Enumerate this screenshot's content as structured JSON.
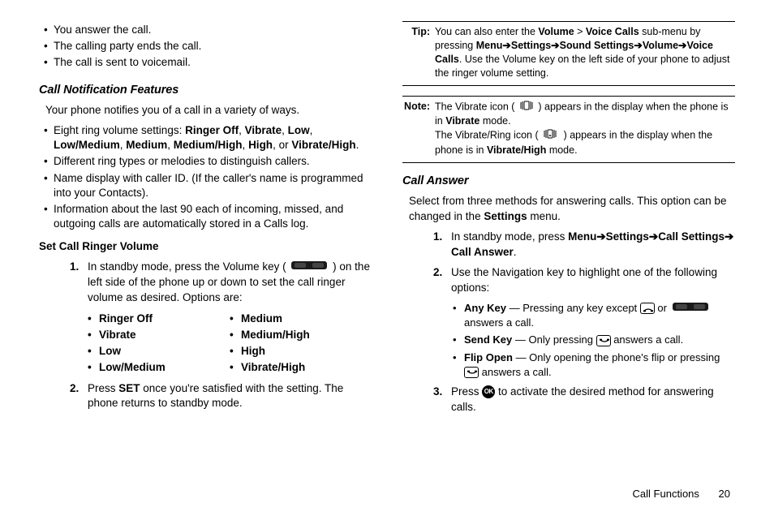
{
  "left": {
    "top_bullets": [
      "You answer the call.",
      "The calling party ends the call.",
      "The call is sent to voicemail."
    ],
    "callnotif_heading": "Call Notification Features",
    "callnotif_intro": "Your phone notifies you of a call in a variety of ways.",
    "feature_bullets": {
      "b1": {
        "pre": "Eight ring volume settings: ",
        "opts": [
          "Ringer Off",
          "Vibrate",
          "Low",
          "Low/Medium",
          "Medium",
          "Medium/High",
          "High",
          "Vibrate/High"
        ],
        "sep": ", ",
        "last_sep": ", or ",
        "end": "."
      },
      "b2": "Different ring types or melodies to distinguish callers.",
      "b3": "Name display with caller ID. (If the caller's name is programmed into your Contacts).",
      "b4": "Information about the last 90 each of incoming, missed, and outgoing calls are automatically stored in a Calls log."
    },
    "setvol_heading": "Set Call Ringer Volume",
    "step1": {
      "num": "1.",
      "pre": "In standby mode, press the Volume key (",
      "post": ") on the left side of the phone up or down to set the call ringer volume as desired. Options are:"
    },
    "opt_col1": [
      "Ringer Off",
      "Vibrate",
      "Low",
      "Low/Medium"
    ],
    "opt_col2": [
      "Medium",
      "Medium/High",
      "High",
      "Vibrate/High"
    ],
    "step2": {
      "num": "2.",
      "text_a": "Press ",
      "bold": "SET",
      "text_b": "  once you're satisfied with the setting. The phone returns to standby mode."
    }
  },
  "right": {
    "tip": {
      "label": "Tip:",
      "parts": {
        "a": "You can also enter the ",
        "vol": "Volume",
        "gt": " > ",
        "vc": "Voice Calls",
        "b": " sub-menu by pressing ",
        "menu": "Menu",
        "arr": " ➔ ",
        "settings": "Settings",
        "ss": "Sound Settings",
        "volume2": "Volume",
        "vc2": "Voice Calls",
        "c": ". Use the Volume key on the left side of your phone to adjust the ringer volume setting."
      }
    },
    "note": {
      "label": "Note:",
      "l1a": "The Vibrate icon (",
      "l1b": ") appears in the display when the phone is in ",
      "l1c": "Vibrate",
      "l1d": " mode.",
      "l2a": "The Vibrate/Ring icon (",
      "l2b": ") appears in the display when the phone is in ",
      "l2c": "Vibrate/High",
      "l2d": " mode."
    },
    "callanswer_heading": "Call Answer",
    "ca_intro_a": "Select from three methods for answering calls. This option can be changed in the ",
    "ca_intro_bold": "Settings",
    "ca_intro_b": " menu.",
    "step1": {
      "num": "1.",
      "a": "In standby mode, press ",
      "menu": "Menu",
      "arr": " ➔ ",
      "settings": "Settings",
      "cs": "Call Settings",
      "ca": "Call Answer",
      "end": "."
    },
    "step2": {
      "num": "2.",
      "text": "Use the Navigation key to highlight one of the following options:"
    },
    "opts": {
      "anykey": {
        "label": "Any Key",
        "a": " — Pressing any key except ",
        "b": " or ",
        "c": " answers a call."
      },
      "sendkey": {
        "label": "Send Key",
        "a": " — Only pressing ",
        "b": " answers a call."
      },
      "flipopen": {
        "label": "Flip Open",
        "a": " — Only opening the phone's flip or pressing ",
        "b": " answers a call."
      }
    },
    "step3": {
      "num": "3.",
      "a": "Press ",
      "b": " to activate the desired method for answering calls."
    }
  },
  "footer": {
    "section": "Call Functions",
    "page": "20"
  }
}
